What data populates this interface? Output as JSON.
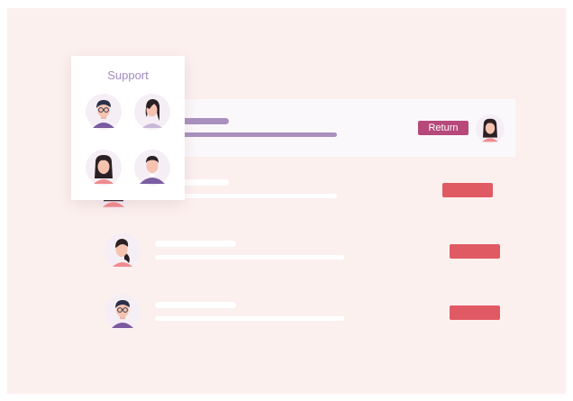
{
  "popover": {
    "title": "Support",
    "agents": [
      {
        "icon": "man-glasses-avatar-icon"
      },
      {
        "icon": "woman-side-hair-avatar-icon"
      },
      {
        "icon": "woman-long-hair-avatar-icon"
      },
      {
        "icon": "man-purple-shirt-avatar-icon"
      }
    ]
  },
  "rows": [
    {
      "state": "selected",
      "action_label": "Return",
      "action_color": "#b7487a",
      "assignee_icon": "woman-avatar-icon"
    },
    {
      "state": "default",
      "action_color": "#e05a64",
      "customer_icon": "woman-avatar-icon"
    },
    {
      "state": "default",
      "action_color": "#e05a64",
      "customer_icon": "woman-ponytail-avatar-icon"
    },
    {
      "state": "default",
      "action_color": "#e05a64",
      "customer_icon": "man-glasses-avatar-icon"
    }
  ],
  "colors": {
    "background": "#fcf0ef",
    "accent_purple": "#a990bf",
    "return_button": "#b7487a",
    "action_button": "#e05a64"
  }
}
